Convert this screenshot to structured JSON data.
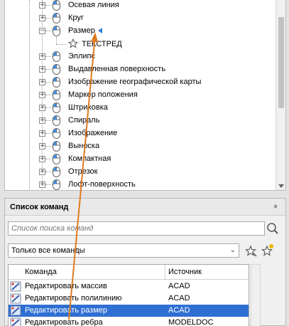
{
  "tree": {
    "items": [
      {
        "label": "Осевая линия",
        "expander": "+"
      },
      {
        "label": "Круг",
        "expander": "+"
      },
      {
        "label": "Размер",
        "expander": "−"
      },
      {
        "label": "Эллипс",
        "expander": "+"
      },
      {
        "label": "Выдавленная поверхность",
        "expander": "+"
      },
      {
        "label": "Изображение географической карты",
        "expander": "+"
      },
      {
        "label": "Маркер положения",
        "expander": "+"
      },
      {
        "label": "Штриховка",
        "expander": "+"
      },
      {
        "label": "Спираль",
        "expander": "+"
      },
      {
        "label": "Изображение",
        "expander": "+"
      },
      {
        "label": "Выноска",
        "expander": "+"
      },
      {
        "label": "Компактная",
        "expander": "+"
      },
      {
        "label": "Отрезок",
        "expander": "+"
      },
      {
        "label": "Лофт-поверхность",
        "expander": "+"
      }
    ],
    "child": {
      "label": "ТЕКСТРЕД"
    }
  },
  "command_list": {
    "title": "Список команд",
    "collapse_glyph": "«",
    "search_placeholder": "Список поиска команд",
    "filter_value": "Только все команды",
    "filter_chevron": "⌄",
    "columns": {
      "command": "Команда",
      "source": "Источник"
    },
    "rows": [
      {
        "command": "Редактировать массив",
        "source": "ACAD",
        "icon": "array-edit-icon"
      },
      {
        "command": "Редактировать полилинию",
        "source": "ACAD",
        "icon": "polyline-edit-icon"
      },
      {
        "command": "Редактировать размер",
        "source": "ACAD",
        "icon": "dimension-edit-icon",
        "selected": true
      },
      {
        "command": "Редактировать ребра",
        "source": "MODELDOC",
        "icon": "edge-edit-icon"
      }
    ]
  },
  "colors": {
    "selection": "#2f6fd3",
    "drag_arrow": "#e07b1f",
    "marker": "#2a7bd6"
  }
}
